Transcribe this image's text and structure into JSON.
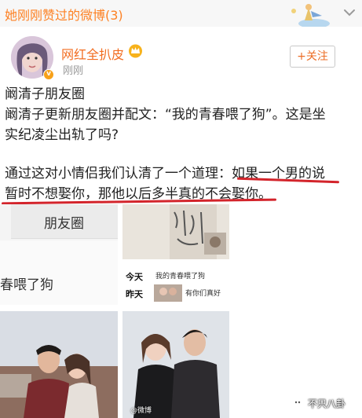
{
  "topbar": {
    "title": "她刚刚赞过的微博(3)"
  },
  "user": {
    "name": "网红全扒皮",
    "time": "刚刚",
    "follow_label": "+关注"
  },
  "post": {
    "line1": "阚清子朋友圈",
    "line2": "阚清子更新朋友圈并配文：“我的青春喂了狗”。这是坐",
    "line3": "实纪凌尘出轨了吗?",
    "line4": "通过这对小情侣我们认清了一个道理：如果一个男的说",
    "line5": "暂时不想娶你，那他以后多半真的不会娶你。"
  },
  "gallery": {
    "left_heading": "朋友圈",
    "left_caption": "春喂了狗",
    "today_label": "今天",
    "today_text": "我的青春喂了狗",
    "yesterday_label": "昨天",
    "yesterday_text": "有你们真好",
    "weibo_tag": "@微博"
  },
  "watermark": {
    "text": "不只八卦"
  },
  "colors": {
    "accent_orange": "#f26d21",
    "title_orange": "#fd8225",
    "underline_red": "#d3242b",
    "vip_badge": "#f7a11a"
  }
}
